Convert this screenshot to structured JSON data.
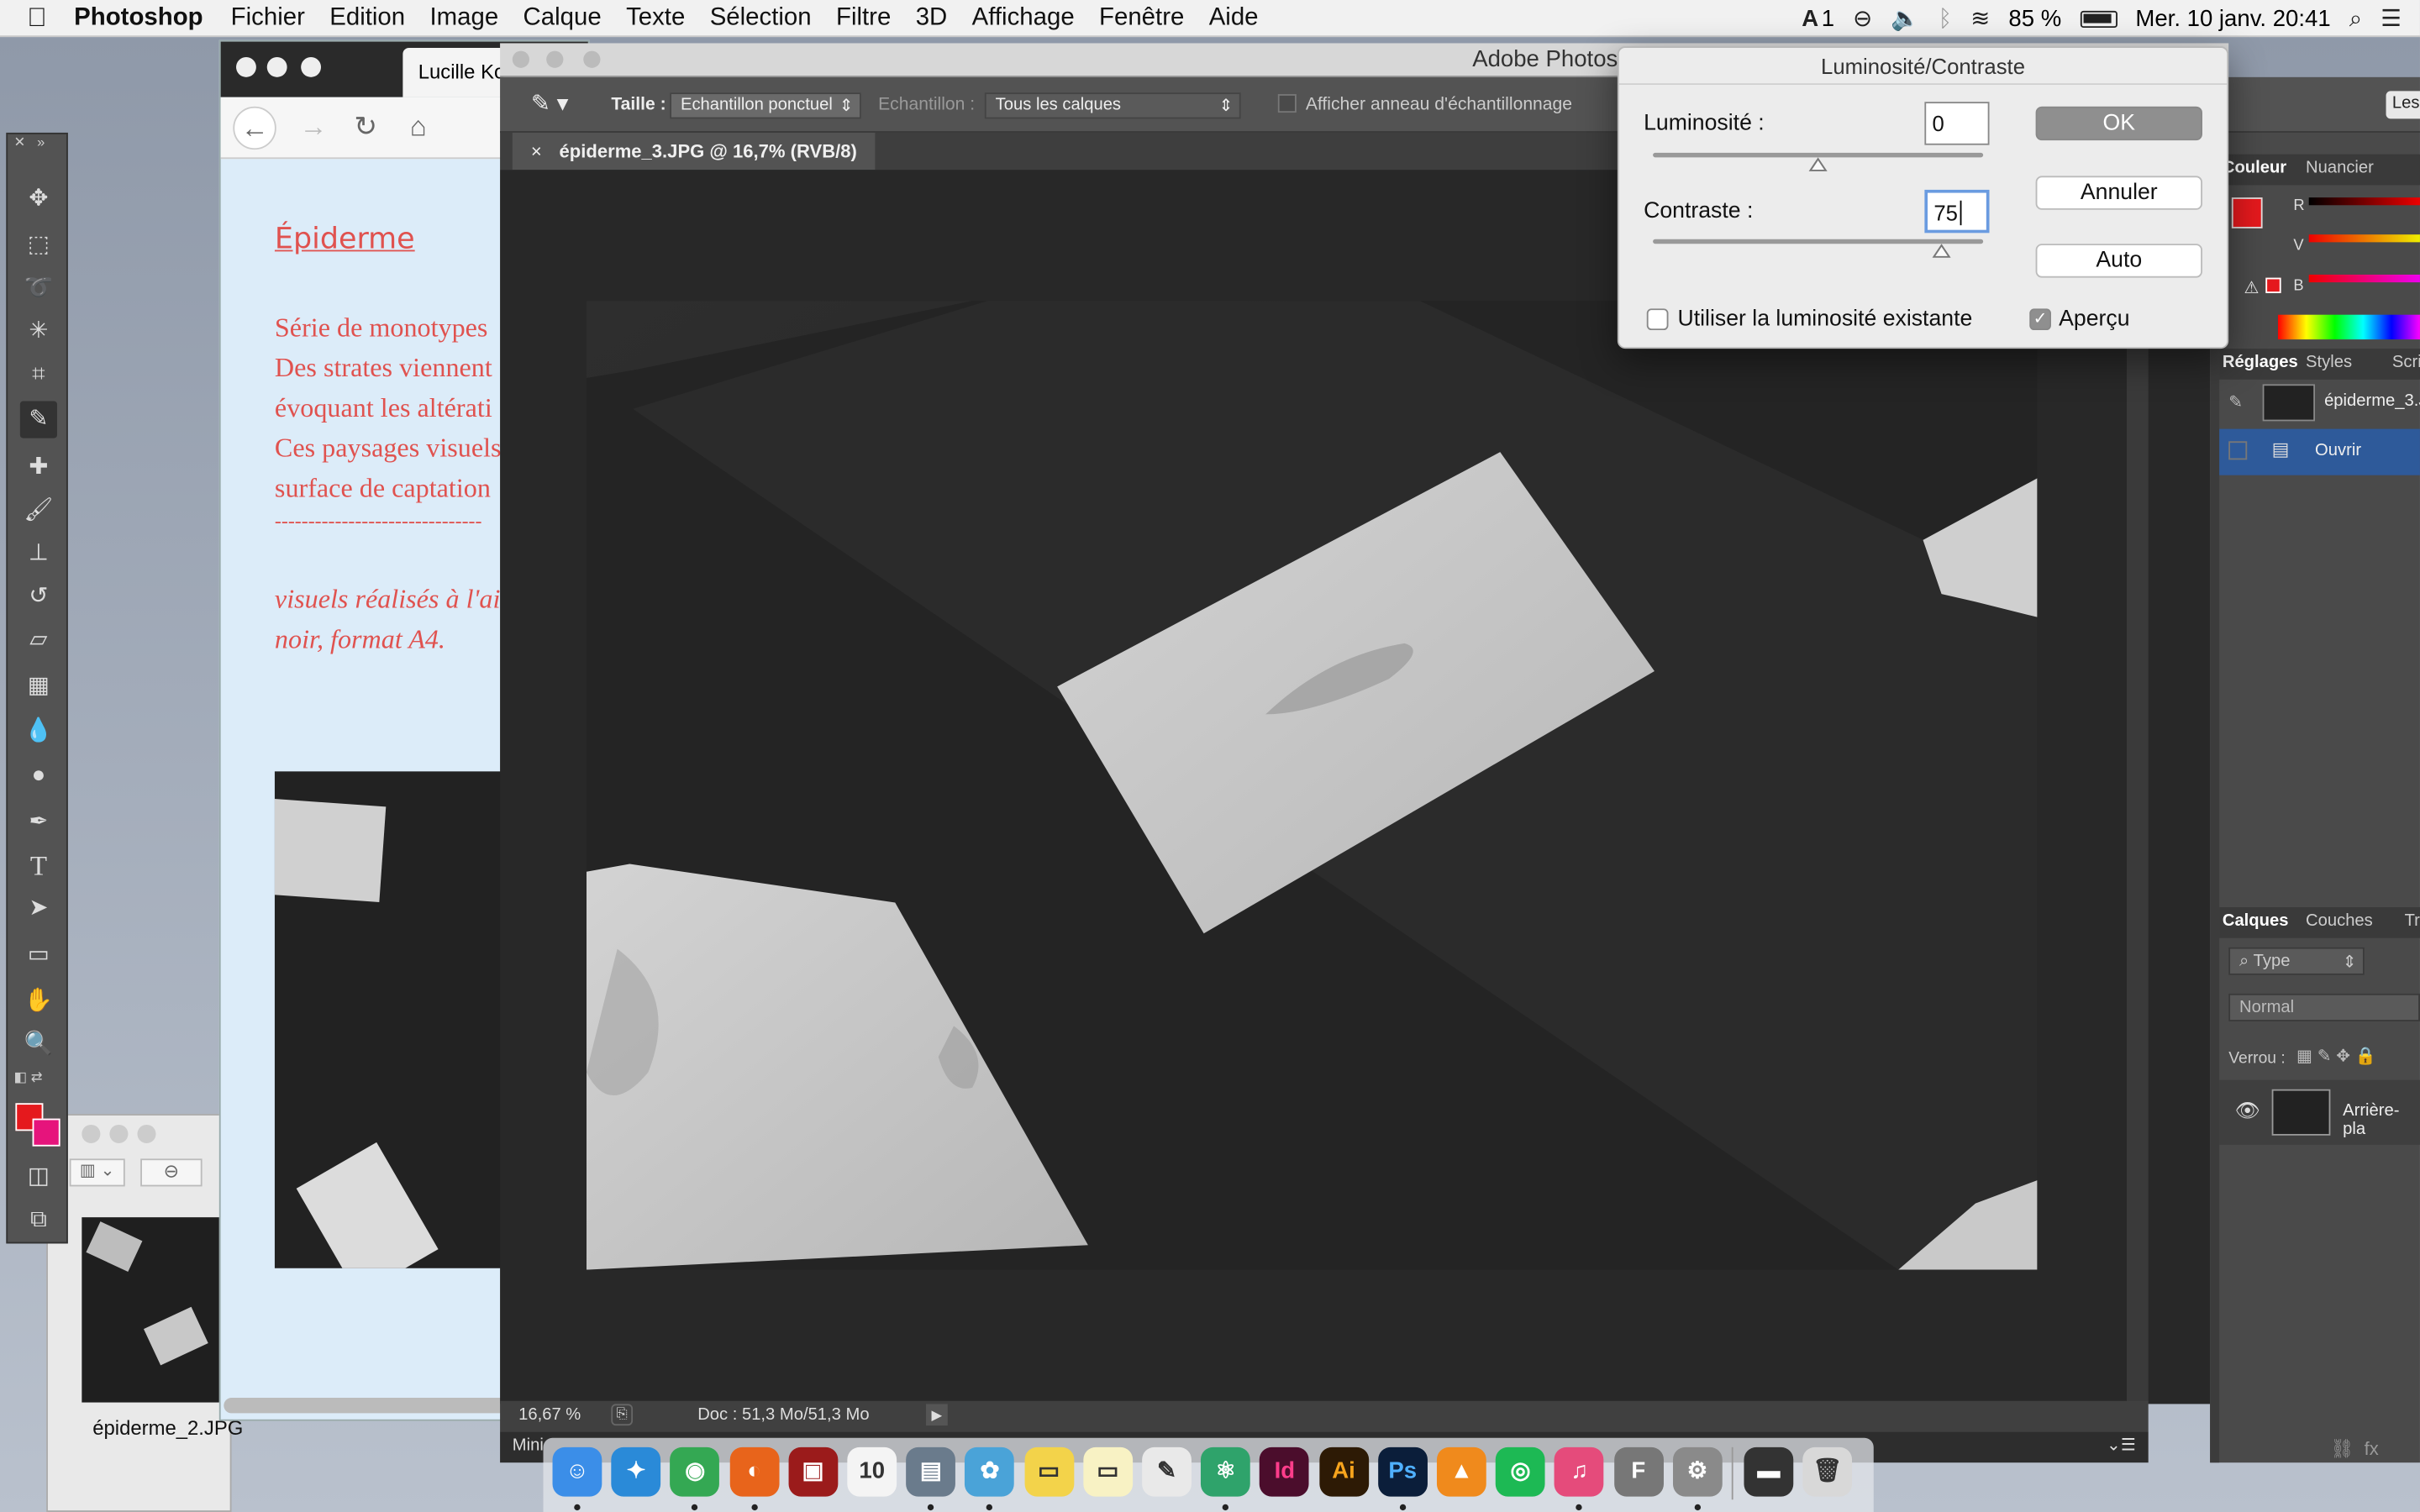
{
  "menubar": {
    "apple": "",
    "app_name": "Photoshop",
    "menus": [
      "Fichier",
      "Edition",
      "Image",
      "Calque",
      "Texte",
      "Sélection",
      "Filtre",
      "3D",
      "Affichage",
      "Fenêtre",
      "Aide"
    ],
    "status": {
      "adobe_count": "1",
      "battery_percent": "85 %",
      "datetime": "Mer. 10 janv.  20:41"
    }
  },
  "browser": {
    "tab_title": "Lucille Ko",
    "heading": "Épiderme",
    "lines": [
      "Série de monotypes",
      "Des strates viennent",
      "évoquant les altérati",
      "Ces paysages visuels",
      "surface de captation",
      "-------------------------------"
    ],
    "italic_lines": [
      "visuels réalisés à l'ai",
      "noir, format A4."
    ]
  },
  "preview": {
    "filename": "épiderme_2.JPG"
  },
  "photoshop": {
    "window_title": "Adobe Photos",
    "options": {
      "size_label": "Taille :",
      "size_value": "Echantillon ponctuel",
      "sample_label": "Echantillon :",
      "sample_value": "Tous les calques",
      "ring_label": "Afficher anneau d'échantillonnage"
    },
    "document_tab": "épiderme_3.JPG @ 16,7% (RVB/8)",
    "zoom": "16,67 %",
    "doc_size": "Doc : 51,3 Mo/51,3 Mo",
    "mini_label": "Mini",
    "panels": {
      "color_tabs": [
        "Couleur",
        "Nuancier"
      ],
      "color_channels": [
        "R",
        "V",
        "B"
      ],
      "adjust_tabs": [
        "Réglages",
        "Styles",
        "Scri"
      ],
      "history": [
        {
          "label": "épiderme_3.JPG"
        },
        {
          "label": "Ouvrir"
        }
      ],
      "layer_tabs": [
        "Calques",
        "Couches",
        "Tr"
      ],
      "layer_filter": "Type",
      "blend_mode": "Normal",
      "lock_label": "Verrou :",
      "layer_name": "Arrière-pla",
      "top_right_button": "Les"
    }
  },
  "dialog": {
    "title": "Luminosité/Contraste",
    "brightness_label": "Luminosité :",
    "brightness_value": "0",
    "brightness_pos": 0.5,
    "contrast_label": "Contraste :",
    "contrast_value": "75",
    "contrast_pos": 0.875,
    "ok": "OK",
    "cancel": "Annuler",
    "auto": "Auto",
    "use_legacy": "Utiliser la luminosité existante",
    "use_legacy_checked": false,
    "preview": "Aperçu",
    "preview_checked": true
  },
  "dock": {
    "icons": [
      {
        "name": "finder-icon",
        "glyph": "☺",
        "color": "#3b8ee8"
      },
      {
        "name": "safari-icon",
        "glyph": "✦",
        "color": "#2a8ad8"
      },
      {
        "name": "chrome-icon",
        "glyph": "◉",
        "color": "#34a853"
      },
      {
        "name": "firefox-icon",
        "glyph": "◐",
        "color": "#e8641b"
      },
      {
        "name": "photo-booth-icon",
        "glyph": "▣",
        "color": "#9b1b1b"
      },
      {
        "name": "calendar-icon",
        "glyph": "10",
        "color": "#f4f4f4"
      },
      {
        "name": "preview-icon",
        "glyph": "▤",
        "color": "#6a7b8c"
      },
      {
        "name": "photos-icon",
        "glyph": "✿",
        "color": "#4aa3d8"
      },
      {
        "name": "stickies-icon",
        "glyph": "▭",
        "color": "#f3d34a"
      },
      {
        "name": "notes-icon",
        "glyph": "▭",
        "color": "#f8f2c4"
      },
      {
        "name": "textedit-icon",
        "glyph": "✎",
        "color": "#e9e9e9"
      },
      {
        "name": "atom-icon",
        "glyph": "⚛",
        "color": "#2fa36b"
      },
      {
        "name": "indesign-icon",
        "glyph": "Id",
        "color": "#4b0d2c"
      },
      {
        "name": "illustrator-icon",
        "glyph": "Ai",
        "color": "#2d1a05"
      },
      {
        "name": "photoshop-icon",
        "glyph": "Ps",
        "color": "#0b1e3a"
      },
      {
        "name": "vlc-icon",
        "glyph": "▲",
        "color": "#f08a1c"
      },
      {
        "name": "spotify-icon",
        "glyph": "◎",
        "color": "#1db954"
      },
      {
        "name": "itunes-icon",
        "glyph": "♫",
        "color": "#e54b7b"
      },
      {
        "name": "fontbook-icon",
        "glyph": "F",
        "color": "#777"
      },
      {
        "name": "system-preferences-icon",
        "glyph": "⚙",
        "color": "#8a8a8a"
      },
      {
        "name": "display-icon",
        "glyph": "▬",
        "color": "#333"
      },
      {
        "name": "trash-icon",
        "glyph": "🗑",
        "color": "#d8d8d8"
      }
    ]
  }
}
